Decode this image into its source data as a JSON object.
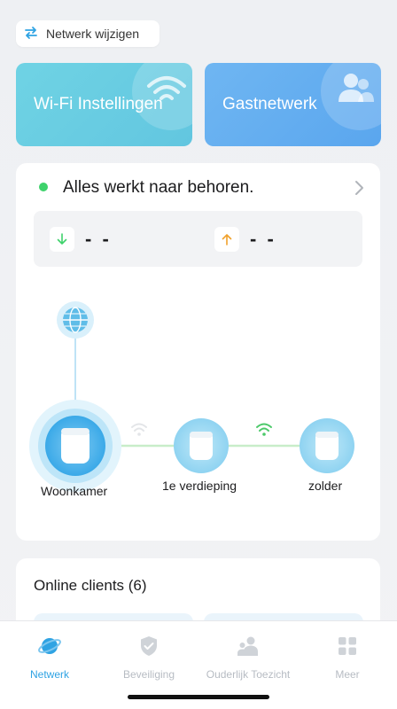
{
  "header": {
    "switch_network_label": "Netwerk wijzigen"
  },
  "tiles": {
    "wifi_label": "Wi-Fi Instellingen",
    "guest_label": "Gastnetwerk"
  },
  "status": {
    "text": "Alles werkt naar behoren.",
    "color": "#3ed26b"
  },
  "speed": {
    "download": "- -",
    "upload": "- -",
    "download_color": "#3ed26b",
    "upload_color": "#f0a12c"
  },
  "topology": {
    "nodes": [
      {
        "label": "Woonkamer"
      },
      {
        "label": "1e verdieping"
      },
      {
        "label": "zolder"
      }
    ]
  },
  "clients": {
    "title": "Online clients (6)"
  },
  "tabbar": {
    "tabs": [
      {
        "label": "Netwerk",
        "active": true,
        "icon": "planet-icon"
      },
      {
        "label": "Beveiliging",
        "active": false,
        "icon": "shield-check-icon"
      },
      {
        "label": "Ouderlijk Toezicht",
        "active": false,
        "icon": "family-icon"
      },
      {
        "label": "Meer",
        "active": false,
        "icon": "grid-icon"
      }
    ],
    "active_color": "#2fa3e3",
    "inactive_color": "#b7bcc3"
  }
}
